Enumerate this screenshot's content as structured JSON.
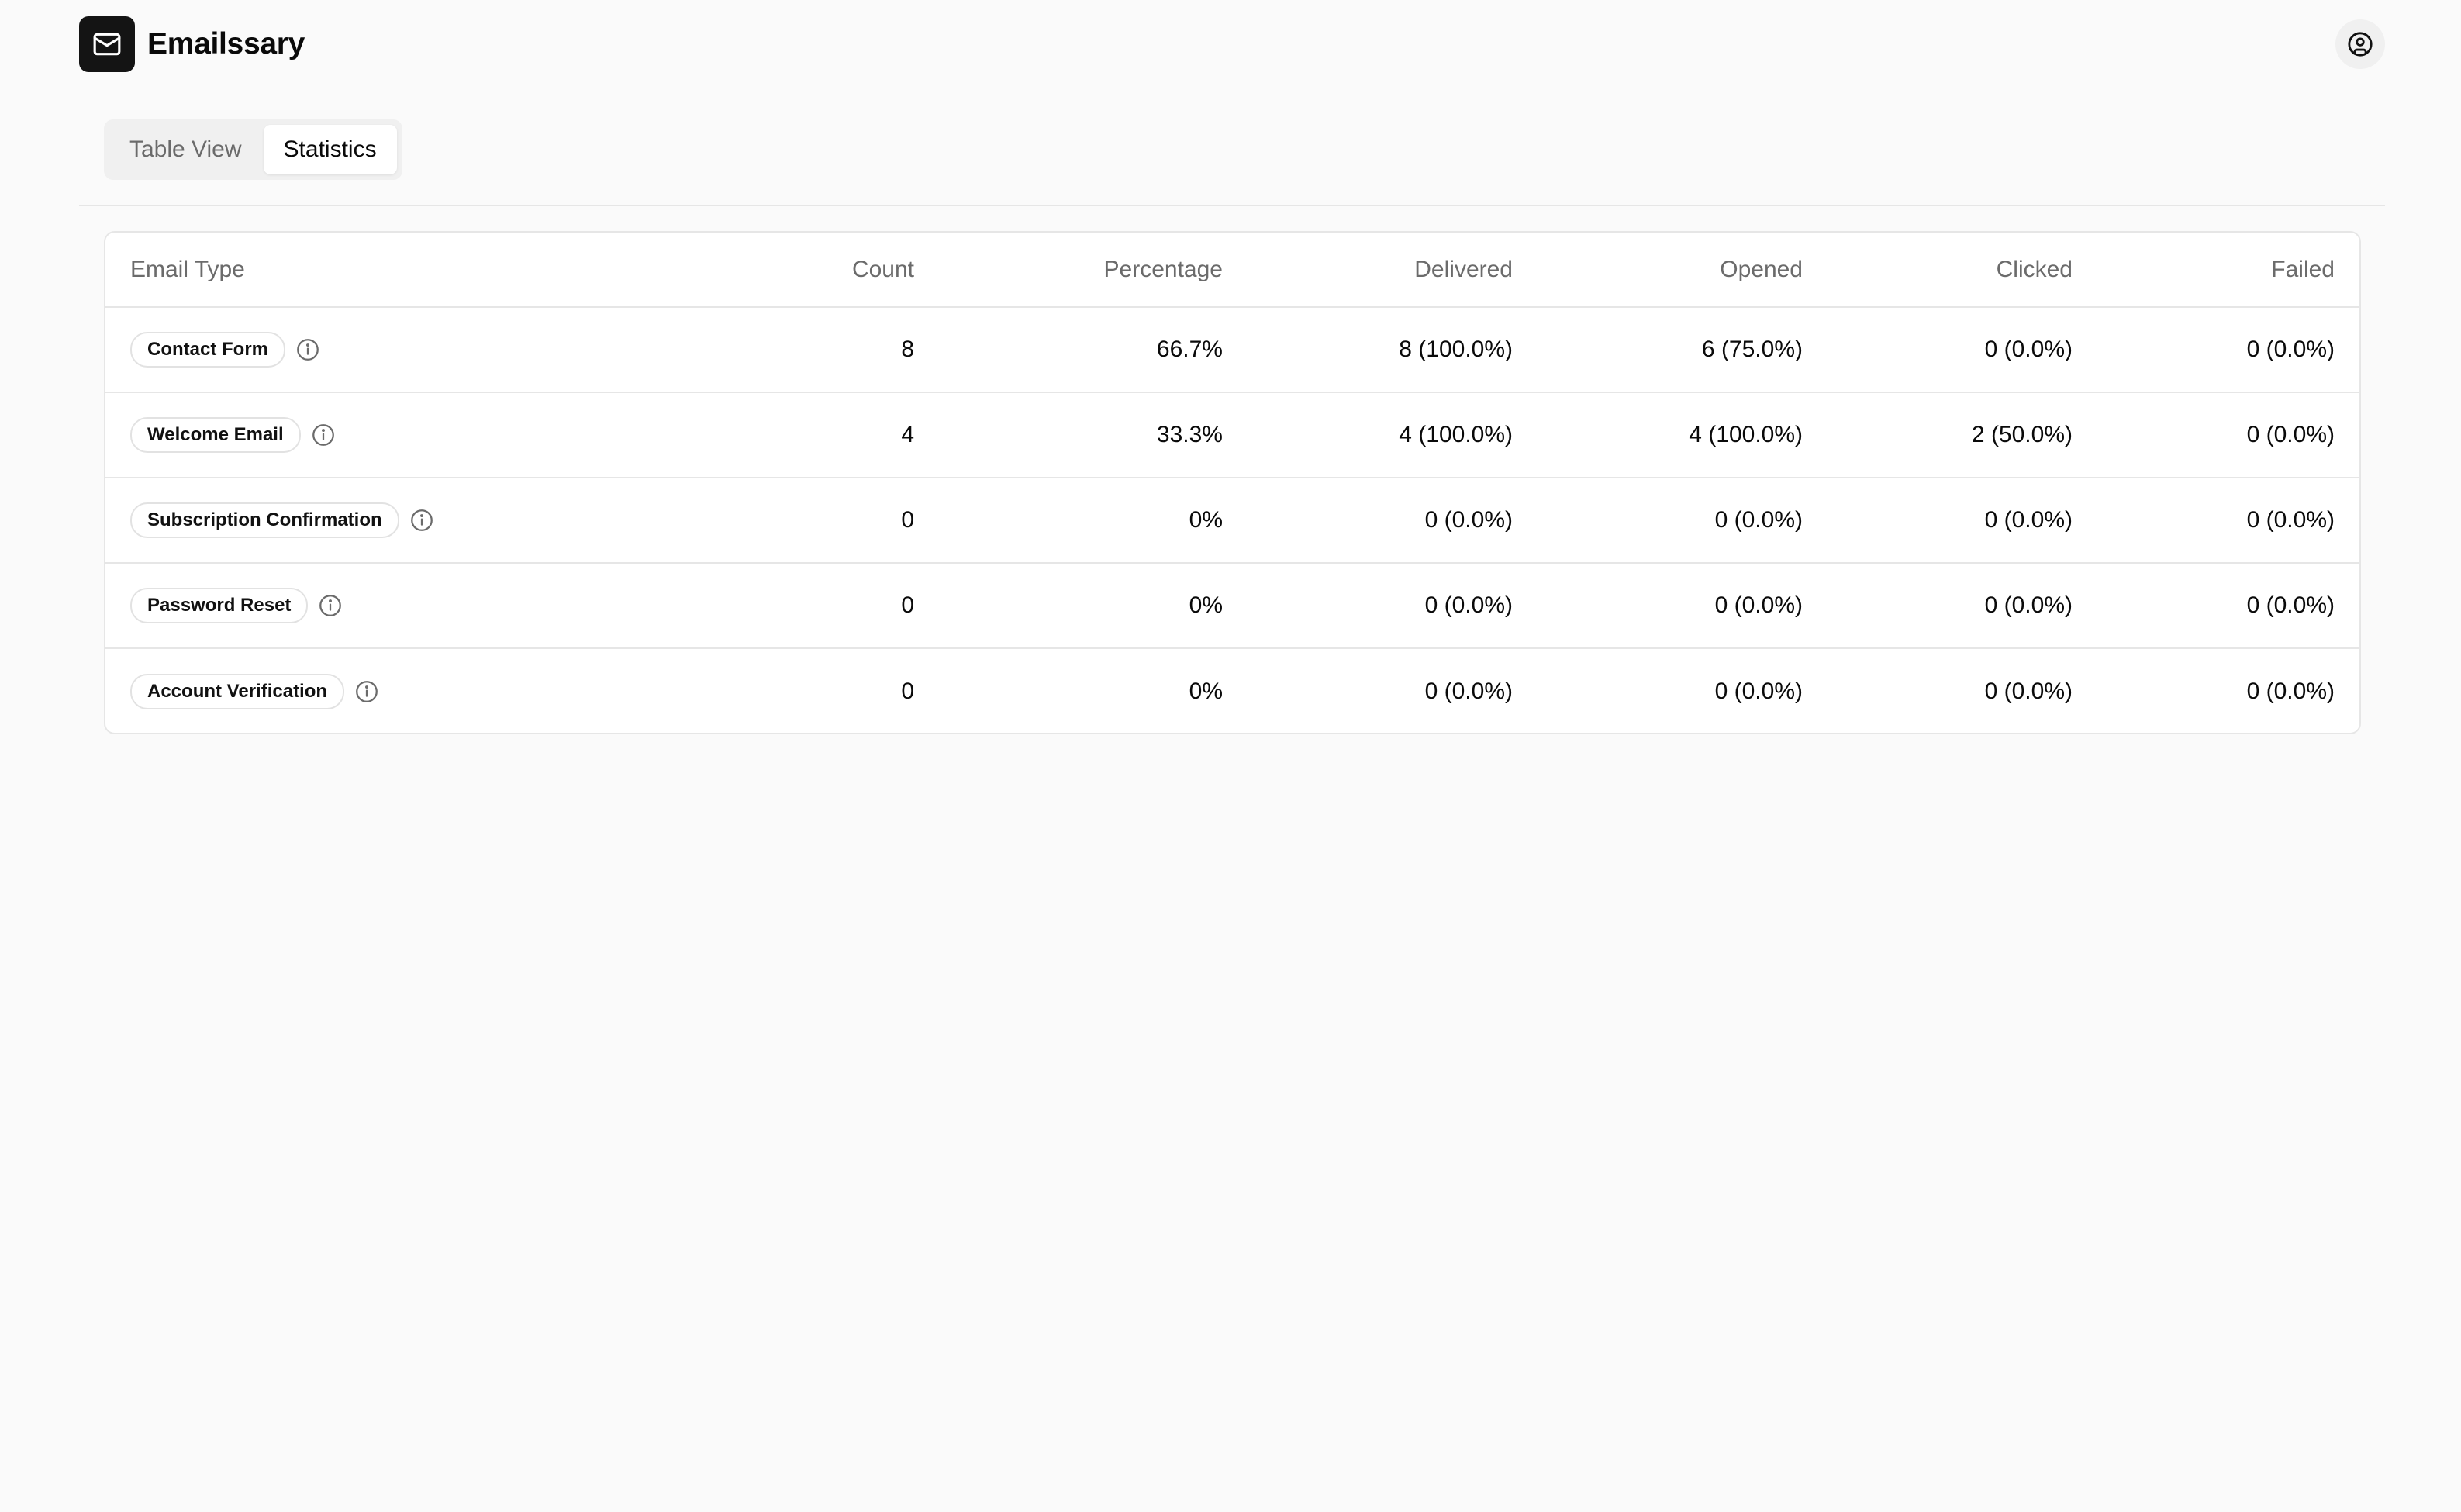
{
  "app": {
    "title": "Emailssary"
  },
  "tabs": [
    {
      "label": "Table View",
      "active": false
    },
    {
      "label": "Statistics",
      "active": true
    }
  ],
  "table": {
    "columns": [
      "Email Type",
      "Count",
      "Percentage",
      "Delivered",
      "Opened",
      "Clicked",
      "Failed"
    ],
    "rows": [
      {
        "type": "Contact Form",
        "count": "8",
        "percentage": "66.7%",
        "delivered": "8 (100.0%)",
        "opened": "6 (75.0%)",
        "clicked": "0 (0.0%)",
        "failed": "0 (0.0%)"
      },
      {
        "type": "Welcome Email",
        "count": "4",
        "percentage": "33.3%",
        "delivered": "4 (100.0%)",
        "opened": "4 (100.0%)",
        "clicked": "2 (50.0%)",
        "failed": "0 (0.0%)"
      },
      {
        "type": "Subscription Confirmation",
        "count": "0",
        "percentage": "0%",
        "delivered": "0 (0.0%)",
        "opened": "0 (0.0%)",
        "clicked": "0 (0.0%)",
        "failed": "0 (0.0%)"
      },
      {
        "type": "Password Reset",
        "count": "0",
        "percentage": "0%",
        "delivered": "0 (0.0%)",
        "opened": "0 (0.0%)",
        "clicked": "0 (0.0%)",
        "failed": "0 (0.0%)"
      },
      {
        "type": "Account Verification",
        "count": "0",
        "percentage": "0%",
        "delivered": "0 (0.0%)",
        "opened": "0 (0.0%)",
        "clicked": "0 (0.0%)",
        "failed": "0 (0.0%)"
      }
    ]
  },
  "icons": {
    "logo": "mail-icon",
    "account": "user-circle-icon",
    "info": "info-icon"
  },
  "colors": {
    "background": "#fafafa",
    "logo_bg": "#141414",
    "border": "#e6e6e6",
    "muted_text": "#6b6b6b"
  }
}
